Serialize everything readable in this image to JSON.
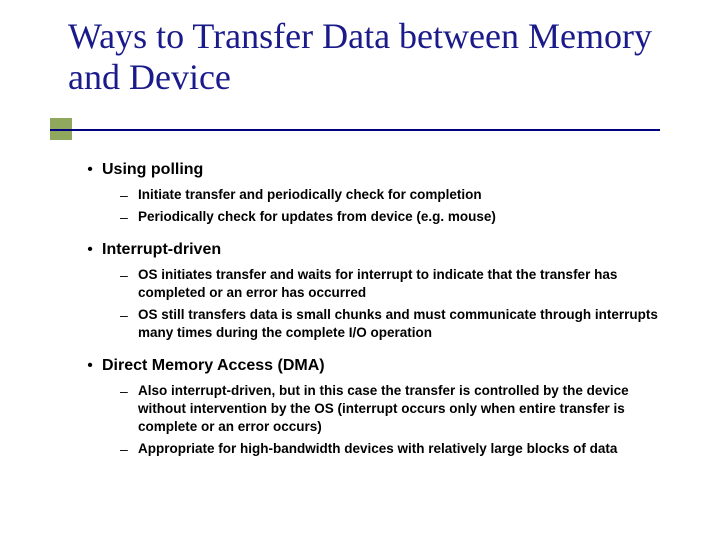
{
  "title": "Ways to Transfer Data between Memory and Device",
  "items": [
    {
      "heading": "Using polling",
      "subs": [
        "Initiate transfer and periodically check for completion",
        "Periodically check for updates from device (e.g. mouse)"
      ]
    },
    {
      "heading": "Interrupt-driven",
      "subs": [
        "OS initiates transfer and waits for interrupt to indicate that the transfer has completed or an error has occurred",
        "OS still transfers data is small chunks and must communicate through interrupts many times during the complete I/O operation"
      ]
    },
    {
      "heading": "Direct Memory Access (DMA)",
      "subs": [
        "Also interrupt-driven, but in this case the transfer is controlled by the device without intervention by the OS (interrupt occurs only when entire transfer is complete or an error occurs)",
        "Appropriate for high-bandwidth devices with relatively large blocks of data"
      ]
    }
  ]
}
